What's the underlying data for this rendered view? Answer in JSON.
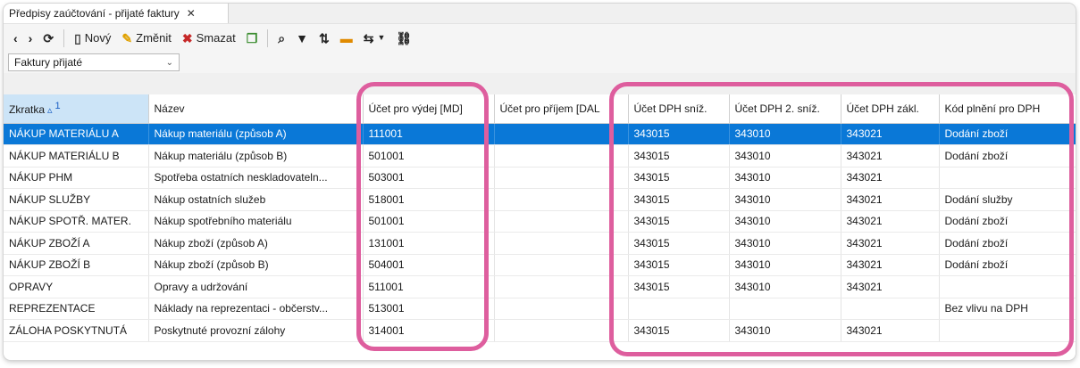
{
  "tab": {
    "title": "Předpisy zaúčtování - přijaté faktury"
  },
  "toolbar": {
    "new_label": "Nový",
    "edit_label": "Změnit",
    "delete_label": "Smazat"
  },
  "filter": {
    "selected": "Faktury přijaté"
  },
  "table": {
    "sort_indicator": "1",
    "columns": [
      "Zkratka",
      "Název",
      "Účet pro výdej [MD]",
      "Účet pro příjem [DAL",
      "Účet DPH sníž.",
      "Účet DPH 2. sníž.",
      "Účet DPH zákl.",
      "Kód plnění pro DPH"
    ],
    "rows": [
      [
        "NÁKUP MATERIÁLU A",
        "Nákup materiálu (způsob A)",
        "111001",
        "",
        "343015",
        "343010",
        "343021",
        "Dodání zboží"
      ],
      [
        "NÁKUP MATERIÁLU B",
        "Nákup materiálu (způsob B)",
        "501001",
        "",
        "343015",
        "343010",
        "343021",
        "Dodání zboží"
      ],
      [
        "NÁKUP PHM",
        "Spotřeba ostatních neskladovateln...",
        "503001",
        "",
        "343015",
        "343010",
        "343021",
        ""
      ],
      [
        "NÁKUP SLUŽBY",
        "Nákup ostatních služeb",
        "518001",
        "",
        "343015",
        "343010",
        "343021",
        "Dodání služby"
      ],
      [
        "NÁKUP SPOTŘ. MATER.",
        "Nákup spotřebního materiálu",
        "501001",
        "",
        "343015",
        "343010",
        "343021",
        "Dodání zboží"
      ],
      [
        "NÁKUP ZBOŽÍ A",
        "Nákup zboží (způsob A)",
        "131001",
        "",
        "343015",
        "343010",
        "343021",
        "Dodání zboží"
      ],
      [
        "NÁKUP ZBOŽÍ B",
        "Nákup zboží (způsob B)",
        "504001",
        "",
        "343015",
        "343010",
        "343021",
        "Dodání zboží"
      ],
      [
        "OPRAVY",
        "Opravy a udržování",
        "511001",
        "",
        "343015",
        "343010",
        "343021",
        ""
      ],
      [
        "REPREZENTACE",
        "Náklady na reprezentaci - občerstv...",
        "513001",
        "",
        "",
        "",
        "",
        "Bez vlivu na DPH"
      ],
      [
        "ZÁLOHA POSKYTNUTÁ",
        "Poskytnuté provozní zálohy",
        "314001",
        "",
        "343015",
        "343010",
        "343021",
        ""
      ]
    ]
  },
  "colors": {
    "selection": "#0a78d7",
    "highlight": "#de5e9e",
    "sorted_header": "#cce4f7"
  }
}
